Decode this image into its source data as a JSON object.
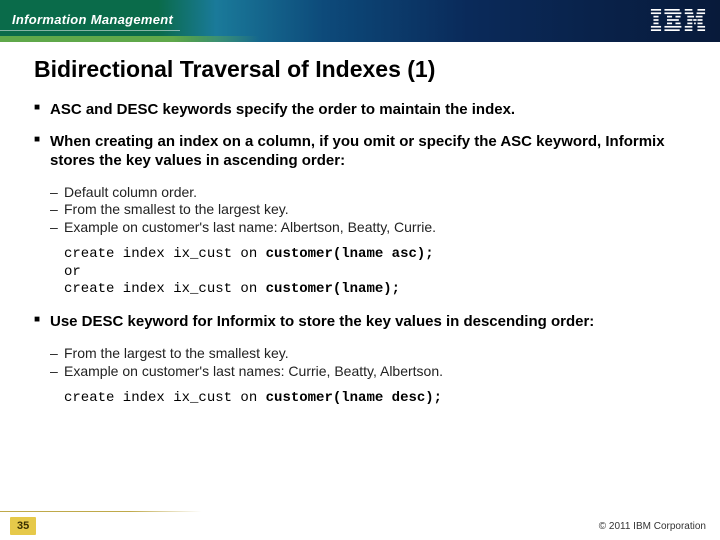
{
  "header": {
    "brand_label": "Information Management",
    "logo_text": "IBM"
  },
  "title": "Bidirectional Traversal of Indexes (1)",
  "bullets": [
    {
      "text": "ASC and DESC keywords specify the order to maintain the index.",
      "sub": [],
      "code": null
    },
    {
      "text": "When creating an index on a column, if you omit or specify the ASC keyword, Informix stores the key values in ascending order:",
      "sub": [
        "Default column order.",
        "From the smallest to the largest key.",
        "Example on customer's last name: Albertson, Beatty, Currie."
      ],
      "code": {
        "line1_plain": "create index ix_cust on ",
        "line1_bold": "customer(lname asc);",
        "or": "or",
        "line2_plain": "create index ix_cust on ",
        "line2_bold": "customer(lname);"
      }
    },
    {
      "text": "Use DESC keyword for Informix to store the key values in descending order:",
      "sub": [
        "From the largest to the smallest key.",
        "Example on customer's last names: Currie, Beatty, Albertson."
      ],
      "code": {
        "line1_plain": "create index ix_cust on ",
        "line1_bold": "customer(lname desc);",
        "or": null,
        "line2_plain": null,
        "line2_bold": null
      }
    }
  ],
  "footer": {
    "page_number": "35",
    "copyright": "© 2011 IBM Corporation"
  }
}
